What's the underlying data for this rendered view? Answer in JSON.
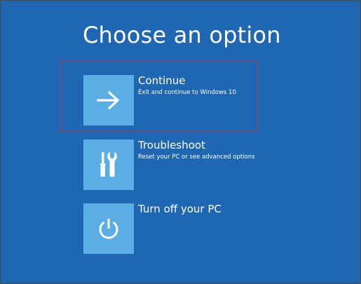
{
  "page": {
    "title": "Choose an option"
  },
  "options": [
    {
      "title": "Continue",
      "description": "Exit and continue to Windows 10",
      "icon": "arrow-right-icon"
    },
    {
      "title": "Troubleshoot",
      "description": "Reset your PC or see advanced options",
      "icon": "tools-icon"
    },
    {
      "title": "Turn off your PC",
      "description": "",
      "icon": "power-icon"
    }
  ],
  "colors": {
    "background": "#1f66b3",
    "tile": "#5aaee3",
    "text": "#ffffff",
    "highlight_border": "#b03a48"
  }
}
